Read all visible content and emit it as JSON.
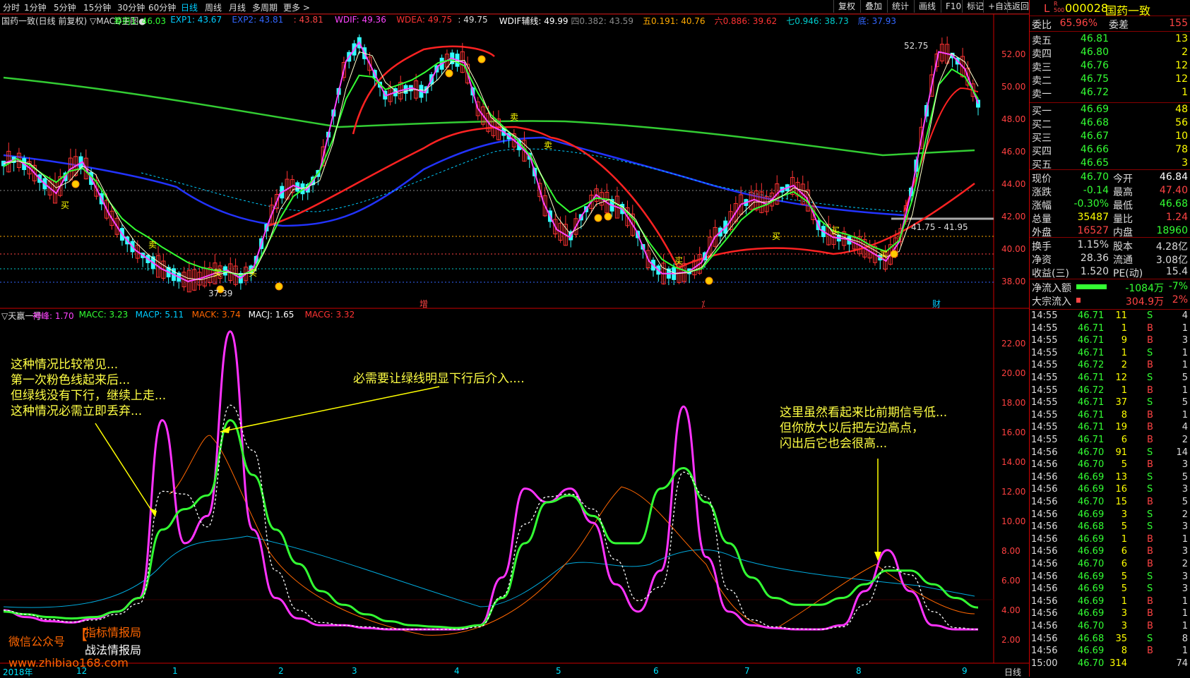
{
  "timeframes": [
    "分时",
    "1分钟",
    "5分钟",
    "15分钟",
    "30分钟",
    "60分钟",
    "日线",
    "周线",
    "月线",
    "多周期",
    "更多 >"
  ],
  "active_timeframe": "日线",
  "toolbar": [
    "复权",
    "叠加",
    "统计",
    "画线",
    "F10",
    "标记",
    "+自选",
    "返回"
  ],
  "main_legend": [
    {
      "t": "国药一致(日线 前复权) ▽MACD主图●",
      "c": "#dddddd"
    },
    {
      "t": "筹码1: 46.03",
      "c": "#33ff33"
    },
    {
      "t": "EXP1: 43.67",
      "c": "#00ccff"
    },
    {
      "t": "EXP2: 43.81",
      "c": "#3366ff"
    },
    {
      "t": ": 43.81",
      "c": "#ff4444"
    },
    {
      "t": "WDIF: 49.36",
      "c": "#ff44ff"
    },
    {
      "t": "WDEA: 49.75",
      "c": "#ff3333"
    },
    {
      "t": ": 49.75",
      "c": "#dddddd"
    },
    {
      "t": "WDIF辅线: 49.99",
      "c": "#ffffff"
    },
    {
      "t": "四0.382: 43.59",
      "c": "#888888"
    },
    {
      "t": "五0.191: 40.76",
      "c": "#ffaa00"
    },
    {
      "t": "六0.886: 39.62",
      "c": "#ff3333"
    },
    {
      "t": "七0.946: 38.73",
      "c": "#00cccc"
    },
    {
      "t": "底: 37.93",
      "c": "#3366ff"
    }
  ],
  "sub_legend": [
    {
      "t": "▽天赢一号",
      "c": "#dddddd"
    },
    {
      "t": "神峰: 1.70",
      "c": "#ff44ff"
    },
    {
      "t": "MACC: 3.23",
      "c": "#33ff33"
    },
    {
      "t": "MACP: 5.11",
      "c": "#00ccff"
    },
    {
      "t": "MACK: 3.74",
      "c": "#ff6600"
    },
    {
      "t": "MACJ: 1.65",
      "c": "#ffffff"
    },
    {
      "t": "MACG: 3.32",
      "c": "#ff3333"
    }
  ],
  "price_axis": [
    "52.00",
    "50.00",
    "48.00",
    "46.00",
    "44.00",
    "42.00",
    "40.00",
    "38.00"
  ],
  "ind_axis": [
    "22.00",
    "20.00",
    "18.00",
    "16.00",
    "14.00",
    "12.00",
    "10.00",
    "8.00",
    "6.00",
    "4.00",
    "2.00"
  ],
  "x_labels": [
    "2018年",
    "12",
    "1",
    "2",
    "3",
    "4",
    "5",
    "6",
    "7",
    "8",
    "9"
  ],
  "x_period": "日线",
  "chart_marks": {
    "high": "52.75",
    "low": "37.39",
    "range": "41.75 - 41.95",
    "buy": "买",
    "sell": "卖",
    "m1": "增",
    "m2": "⁒",
    "m3": "财"
  },
  "annotations": {
    "left": [
      "这种情况比较常见...",
      "第一次粉色线起来后...",
      "但绿线没有下行，继续上走...",
      "这种情况必需立即丢弃..."
    ],
    "middle": "必需要让绿线明显下行后介入....",
    "right": [
      "这里虽然看起来比前期信号低...",
      "但你放大以后把左边高点，",
      "闪出后它也会很高..."
    ]
  },
  "watermark": {
    "left": "微信公众号",
    "bracket": "【",
    "line1": "指标情报局",
    "line2": "战法情报局",
    "url": "www.zhibiao168.com"
  },
  "stock": {
    "flag": "L",
    "tag": "R 500",
    "code": "000028",
    "name": "国药一致"
  },
  "order_ratio": {
    "label": "委比",
    "value": "65.96%",
    "diff_label": "委差",
    "diff": "155"
  },
  "asks": [
    {
      "l": "卖五",
      "p": "46.81",
      "v": "13"
    },
    {
      "l": "卖四",
      "p": "46.80",
      "v": "2"
    },
    {
      "l": "卖三",
      "p": "46.76",
      "v": "12"
    },
    {
      "l": "卖二",
      "p": "46.75",
      "v": "12"
    },
    {
      "l": "卖一",
      "p": "46.72",
      "v": "1"
    }
  ],
  "bids": [
    {
      "l": "买一",
      "p": "46.69",
      "v": "48"
    },
    {
      "l": "买二",
      "p": "46.68",
      "v": "56"
    },
    {
      "l": "买三",
      "p": "46.67",
      "v": "10"
    },
    {
      "l": "买四",
      "p": "46.66",
      "v": "78"
    },
    {
      "l": "买五",
      "p": "46.65",
      "v": "3"
    }
  ],
  "quote": [
    {
      "l": "现价",
      "v": "46.70",
      "vc": "#33ff33",
      "l2": "今开",
      "v2": "46.84",
      "v2c": "#ffffff"
    },
    {
      "l": "涨跌",
      "v": "-0.14",
      "vc": "#33ff33",
      "l2": "最高",
      "v2": "47.40",
      "v2c": "#ff4444"
    },
    {
      "l": "涨幅",
      "v": "-0.30%",
      "vc": "#33ff33",
      "l2": "最低",
      "v2": "46.68",
      "v2c": "#33ff33"
    },
    {
      "l": "总量",
      "v": "35487",
      "vc": "#ffff00",
      "l2": "量比",
      "v2": "1.24",
      "v2c": "#ff4444"
    },
    {
      "l": "外盘",
      "v": "16527",
      "vc": "#ff4444",
      "l2": "内盘",
      "v2": "18960",
      "v2c": "#33ff33"
    }
  ],
  "fund": [
    {
      "l": "换手",
      "v": "1.15%",
      "l2": "股本",
      "v2": "4.28亿"
    },
    {
      "l": "净资",
      "v": "28.36",
      "l2": "流通",
      "v2": "3.08亿"
    },
    {
      "l": "收益(三)",
      "v": "1.520",
      "l2": "PE(动)",
      "v2": "15.4"
    }
  ],
  "flows": [
    {
      "l": "净流入额",
      "v": "-1084万",
      "p": "-7%",
      "c": "#33ff33",
      "level": 0.85
    },
    {
      "l": "大宗流入",
      "v": "304.9万",
      "p": "2%",
      "c": "#ff4444",
      "level": 0.12
    }
  ],
  "ticks": [
    [
      "14:55",
      "46.71",
      "11",
      "S",
      "4"
    ],
    [
      "14:55",
      "46.71",
      "1",
      "B",
      "1"
    ],
    [
      "14:55",
      "46.71",
      "9",
      "B",
      "3"
    ],
    [
      "14:55",
      "46.71",
      "1",
      "S",
      "1"
    ],
    [
      "14:55",
      "46.72",
      "2",
      "B",
      "1"
    ],
    [
      "14:55",
      "46.71",
      "12",
      "S",
      "5"
    ],
    [
      "14:55",
      "46.72",
      "1",
      "B",
      "1"
    ],
    [
      "14:55",
      "46.71",
      "37",
      "S",
      "5"
    ],
    [
      "14:55",
      "46.71",
      "8",
      "B",
      "1"
    ],
    [
      "14:55",
      "46.71",
      "19",
      "B",
      "4"
    ],
    [
      "14:55",
      "46.71",
      "6",
      "B",
      "2"
    ],
    [
      "14:56",
      "46.70",
      "91",
      "S",
      "14"
    ],
    [
      "14:56",
      "46.70",
      "5",
      "B",
      "3"
    ],
    [
      "14:56",
      "46.69",
      "13",
      "S",
      "5"
    ],
    [
      "14:56",
      "46.69",
      "16",
      "S",
      "3"
    ],
    [
      "14:56",
      "46.70",
      "15",
      "B",
      "5"
    ],
    [
      "14:56",
      "46.69",
      "3",
      "S",
      "2"
    ],
    [
      "14:56",
      "46.68",
      "5",
      "S",
      "3"
    ],
    [
      "14:56",
      "46.69",
      "1",
      "B",
      "1"
    ],
    [
      "14:56",
      "46.69",
      "6",
      "B",
      "3"
    ],
    [
      "14:56",
      "46.70",
      "6",
      "B",
      "2"
    ],
    [
      "14:56",
      "46.69",
      "5",
      "S",
      "3"
    ],
    [
      "14:56",
      "46.69",
      "5",
      "S",
      "3"
    ],
    [
      "14:56",
      "46.69",
      "1",
      "B",
      "1"
    ],
    [
      "14:56",
      "46.69",
      "3",
      "B",
      "1"
    ],
    [
      "14:56",
      "46.70",
      "3",
      "B",
      "1"
    ],
    [
      "14:56",
      "46.68",
      "35",
      "S",
      "8"
    ],
    [
      "14:56",
      "46.69",
      "8",
      "B",
      "1"
    ],
    [
      "15:00",
      "46.70",
      "314",
      "",
      "74"
    ]
  ],
  "chart_data": [
    {
      "type": "line",
      "title": "国药一致(日线 前复权)",
      "ylim": [
        37.5,
        53.2
      ],
      "series": [
        {
          "name": "WDIF",
          "values": [
            45.5,
            45.8,
            45.2,
            44.3,
            43.6,
            45.1,
            45.6,
            44.0,
            42.3,
            41.0,
            40.0,
            39.4,
            38.8,
            38.4,
            38.0,
            38.2,
            38.5,
            38.7,
            38.2,
            38.9,
            41.5,
            43.6,
            44.1,
            43.8,
            45.0,
            48.5,
            52.0,
            53.2,
            51.5,
            49.8,
            50.1,
            50.3,
            50.0,
            51.7,
            52.2,
            51.9,
            49.0,
            47.9,
            47.5,
            46.8,
            45.9,
            43.0,
            41.3,
            40.8,
            42.3,
            43.5,
            42.9,
            42.6,
            41.3,
            39.3,
            38.5,
            38.5,
            38.6,
            39.2,
            40.8,
            41.6,
            42.9,
            43.2,
            42.9,
            43.8,
            44.1,
            43.3,
            41.3,
            40.8,
            40.7,
            40.3,
            39.8,
            39.3,
            40.5,
            44.0,
            48.5,
            52.6,
            52.4,
            51.5,
            49.3
          ]
        },
        {
          "name": "MACC",
          "values": [
            45.3,
            45.8,
            45.4,
            44.8,
            44.3,
            45.0,
            45.2,
            44.4,
            43.1,
            42.0,
            41.3,
            40.8,
            40.2,
            39.7,
            39.2,
            38.9,
            38.7,
            38.6,
            38.4,
            38.7,
            40.3,
            42.0,
            43.4,
            44.0,
            45.0,
            47.0,
            49.6,
            51.1,
            51.0,
            50.2,
            50.5,
            50.8,
            51.3,
            51.9,
            52.1,
            51.7,
            50.0,
            48.6,
            47.8,
            47.0,
            46.0,
            44.5,
            43.1,
            42.4,
            42.8,
            43.3,
            43.2,
            42.7,
            41.8,
            40.5,
            39.4,
            38.9,
            38.6,
            38.8,
            39.8,
            40.8,
            41.9,
            42.6,
            42.9,
            43.4,
            43.7,
            43.1,
            41.9,
            41.2,
            41.0,
            40.7,
            40.2,
            39.9,
            40.6,
            43.2,
            46.9,
            50.5,
            51.5,
            51.0,
            49.6
          ]
        }
      ]
    },
    {
      "type": "line",
      "title": "天赢一号",
      "series": [
        {
          "name": "神峰",
          "values": [
            3.1,
            2.6,
            2.3,
            2.2,
            2.5,
            3.0,
            4.0,
            17.0,
            8.0,
            10.0,
            23.5,
            9.0,
            4.0,
            2.5,
            2.0,
            2.0,
            1.8,
            1.7,
            1.7,
            1.7,
            1.7,
            2.0,
            5.5,
            12.0,
            11.0,
            12.0,
            9.5,
            5.0,
            3.0,
            6.0,
            18.0,
            7.0,
            3.0,
            2.0,
            1.8,
            1.7,
            1.7,
            2.0,
            4.5,
            7.5,
            4.5,
            2.0,
            1.7,
            1.7
          ]
        },
        {
          "name": "MACC",
          "values": [
            3.0,
            2.8,
            2.6,
            2.5,
            2.6,
            3.0,
            4.0,
            9.0,
            10.5,
            11.5,
            17.0,
            13.0,
            9.0,
            6.5,
            4.5,
            3.5,
            2.8,
            2.3,
            2.0,
            1.9,
            1.8,
            2.0,
            4.0,
            8.0,
            11.0,
            11.5,
            10.0,
            8.0,
            8.0,
            12.0,
            13.5,
            11.0,
            8.0,
            5.5,
            4.0,
            3.5,
            3.5,
            4.0,
            5.0,
            6.0,
            6.0,
            5.0,
            4.0,
            3.3
          ]
        }
      ]
    }
  ]
}
